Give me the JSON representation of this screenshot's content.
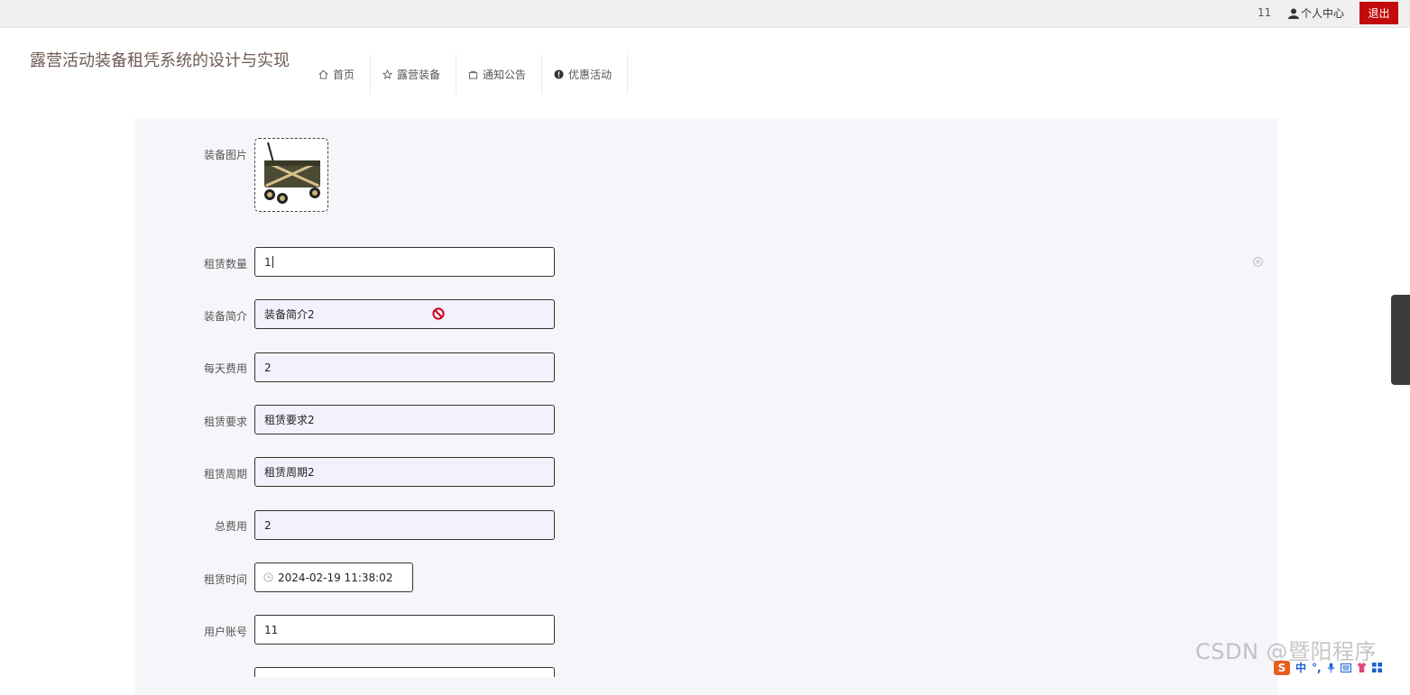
{
  "topbar": {
    "user_id": "11",
    "center_label": "个人中心",
    "logout_label": "退出"
  },
  "header": {
    "site_title": "露营活动装备租凭系统的设计与实现"
  },
  "nav": [
    {
      "label": "首页",
      "icon": "home-icon"
    },
    {
      "label": "露营装备",
      "icon": "star-icon"
    },
    {
      "label": "通知公告",
      "icon": "bag-icon"
    },
    {
      "label": "优惠活动",
      "icon": "alert-circle-icon"
    }
  ],
  "form": {
    "image_label": "装备图片",
    "quantity": {
      "label": "租赁数量",
      "value": "1"
    },
    "intro": {
      "label": "装备简介",
      "value": "装备简介2"
    },
    "daily_fee": {
      "label": "每天费用",
      "value": "2"
    },
    "requirement": {
      "label": "租赁要求",
      "value": "租赁要求2"
    },
    "period": {
      "label": "租赁周期",
      "value": "租赁周期2"
    },
    "total_fee": {
      "label": "总费用",
      "value": "2"
    },
    "rent_time": {
      "label": "租赁时间",
      "value": "2024-02-19 11:38:02"
    },
    "account": {
      "label": "用户账号",
      "value": "11"
    }
  },
  "watermark": "CSDN @暨阳程序",
  "ime": {
    "logo": "S",
    "items": [
      "中",
      "°,"
    ]
  },
  "colors": {
    "accent": "#c20c0c",
    "panel": "#f6f6fa",
    "title": "#6d5b52"
  }
}
